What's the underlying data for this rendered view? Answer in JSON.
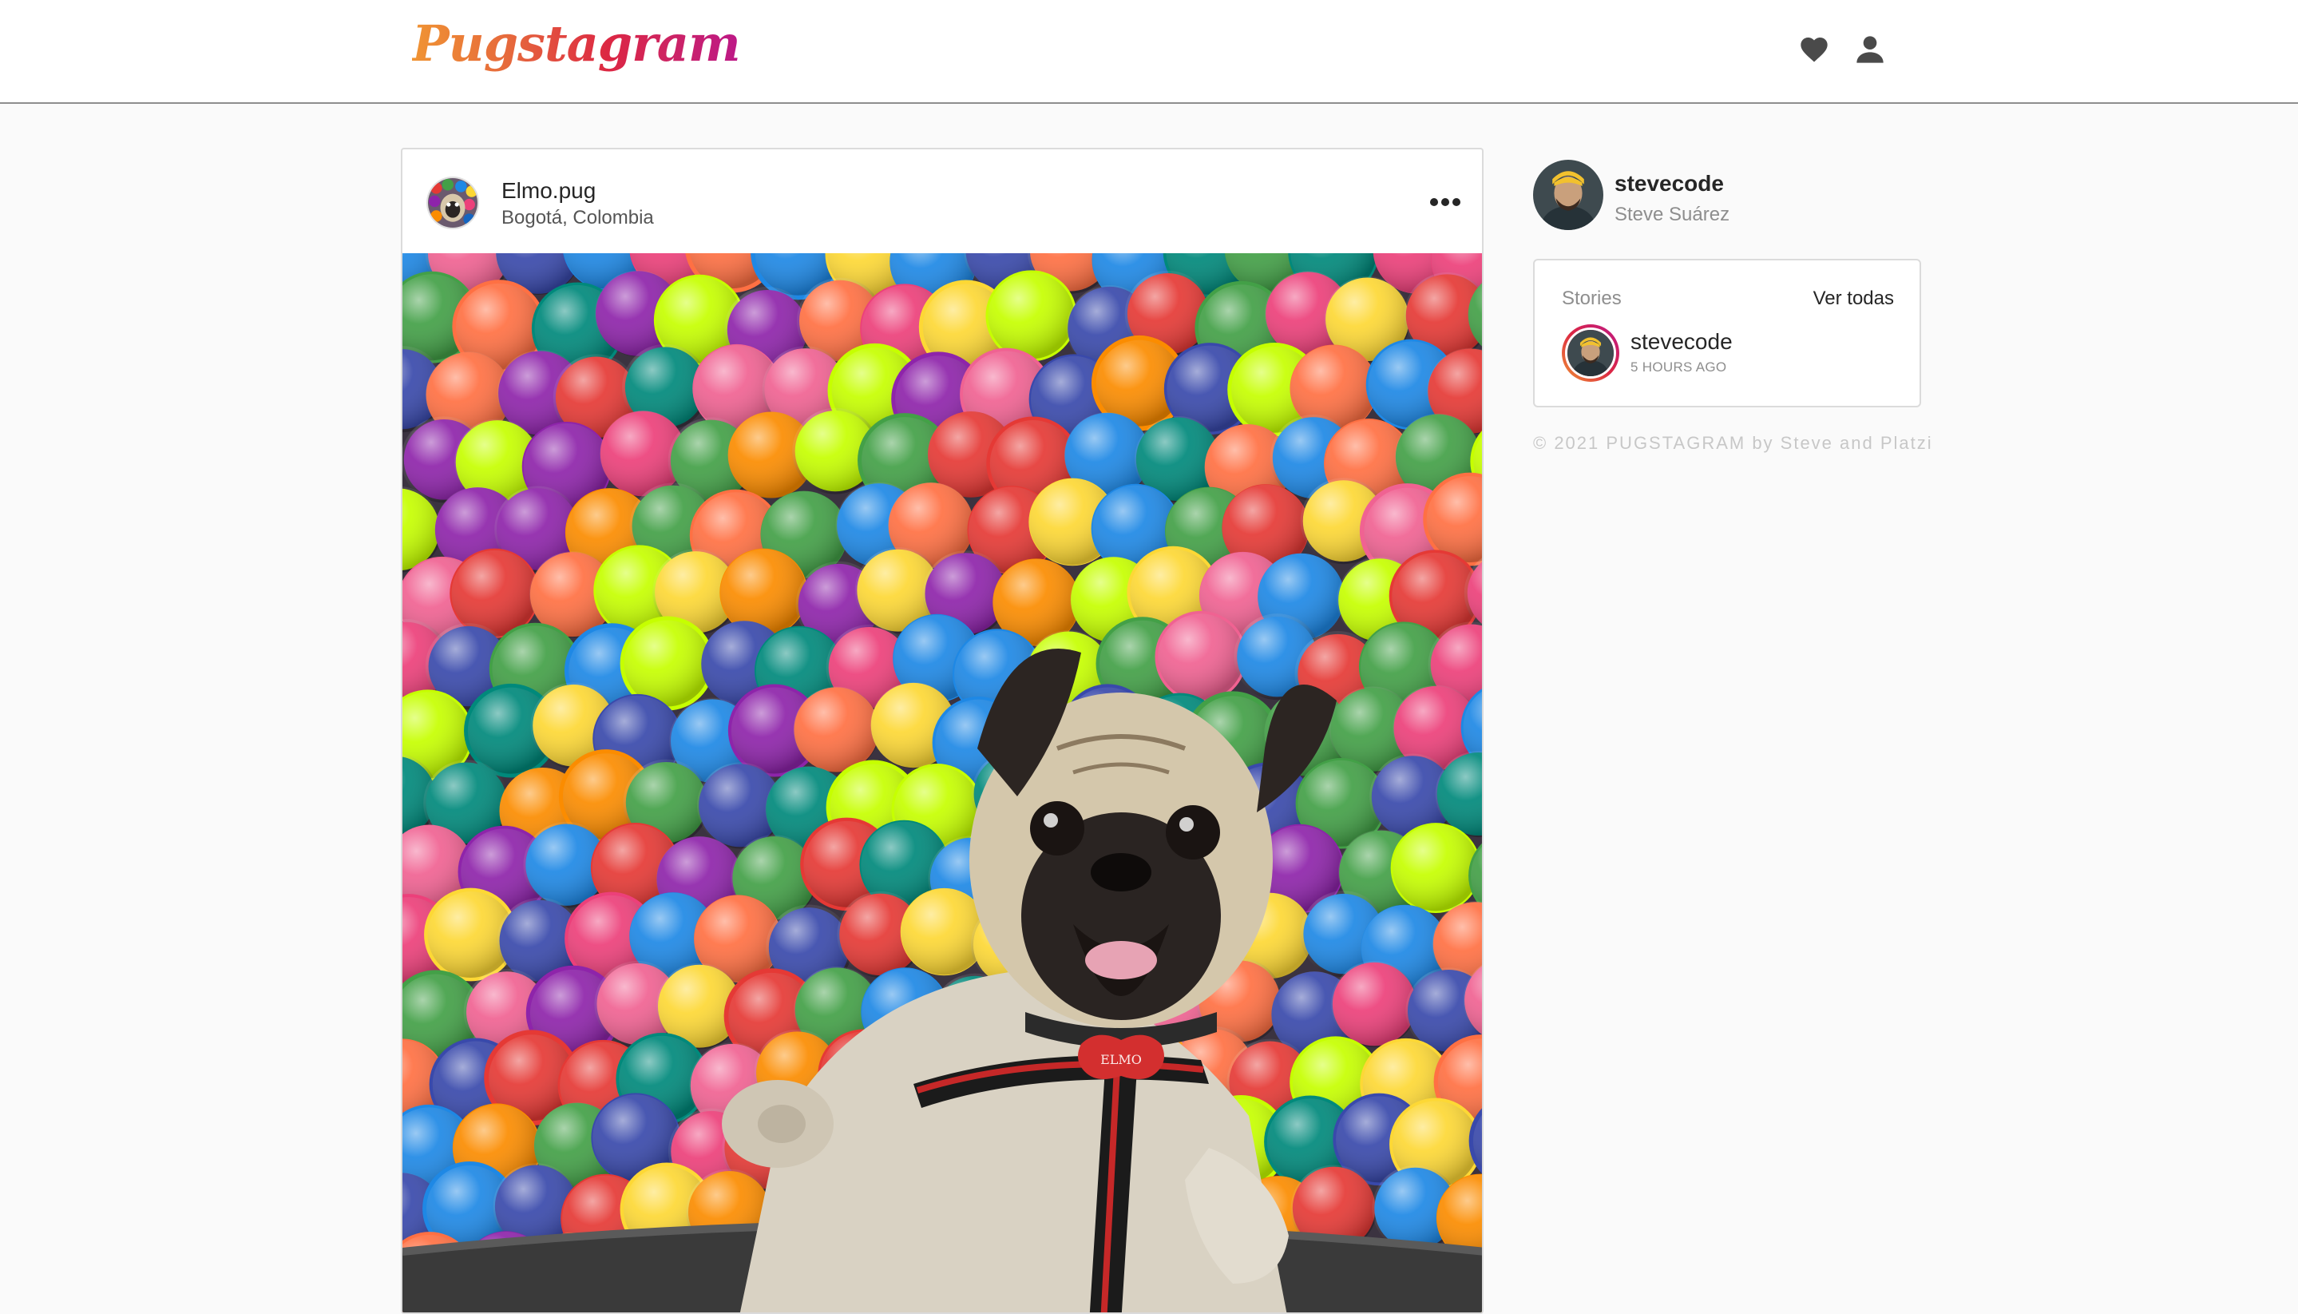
{
  "header": {
    "logo": "Pugstagram",
    "icons": [
      "heart-icon",
      "user-icon"
    ]
  },
  "post": {
    "username": "Elmo.pug",
    "location": "Bogotá, Colombia",
    "more_icon": "ellipsis-icon",
    "tag_text": "ELMO"
  },
  "sidebar": {
    "username": "stevecode",
    "full_name": "Steve Suárez",
    "stories": {
      "title": "Stories",
      "see_all": "Ver todas",
      "items": [
        {
          "username": "stevecode",
          "time": "5 HOURS AGO"
        }
      ]
    },
    "footer": "© 2021 PUGSTAGRAM by Steve and Platzi"
  },
  "colors": {
    "background": "#fafafa",
    "card": "#ffffff",
    "border": "#dbdbdb",
    "muted": "#8e8e8e",
    "logo_gradient": [
      "#f09433",
      "#e6683c",
      "#dc2743",
      "#bc1888"
    ]
  }
}
